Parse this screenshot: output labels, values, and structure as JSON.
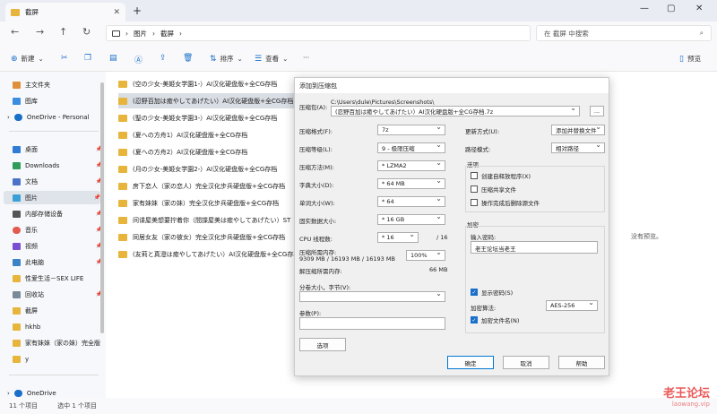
{
  "window": {
    "tab_title": "截屏",
    "tab_close": "✕",
    "new_tab": "+",
    "minimize": "—",
    "maximize": "▢",
    "close": "✕"
  },
  "address": {
    "crumb1": "图片",
    "crumb2": "截屏",
    "search_placeholder": "在 截屏 中搜索"
  },
  "toolbar": {
    "new_label": "新建",
    "sort_label": "排序",
    "view_label": "查看",
    "more_label": "···",
    "details_label": "预览"
  },
  "sidebar": {
    "items": [
      {
        "label": "主文件夹",
        "color": "#e0903a"
      },
      {
        "label": "图库",
        "color": "#3b8de0"
      },
      {
        "label": "OneDrive - Personal",
        "color": "#1a6fc9"
      },
      {
        "label": "桌面",
        "color": "#2f7bd6"
      },
      {
        "label": "Downloads",
        "color": "#2f9c5a"
      },
      {
        "label": "文档",
        "color": "#4b74c9"
      },
      {
        "label": "图片",
        "color": "#3ca0d8"
      },
      {
        "label": "内部存储设备",
        "color": "#555555"
      },
      {
        "label": "音乐",
        "color": "#e35a4f"
      },
      {
        "label": "视频",
        "color": "#7a4fd1"
      },
      {
        "label": "此电脑",
        "color": "#3c82c7"
      },
      {
        "label": "性爱生活－SEX LIFE",
        "color": "#e7b53c"
      },
      {
        "label": "回收站",
        "color": "#7a8a9a"
      },
      {
        "label": "截屏",
        "color": "#e7b53c"
      },
      {
        "label": "hkhb",
        "color": "#e7b53c"
      },
      {
        "label": "家有妹妹（家の妹）完全版",
        "color": "#e7b53c"
      },
      {
        "label": "y",
        "color": "#e7b53c"
      },
      {
        "label": "OneDrive",
        "color": "#1a6fc9"
      }
    ]
  },
  "files": [
    "(空の少女-美姫女学園1-）AI汉化硬盘版+全CG存档",
    "(忍野百加は癒やしてあげたい）AI汉化硬盘版+全CG存档",
    "(聖の少女-美姫女学園3-）AI汉化硬盘版+全CG存档",
    "(夏への方舟1）AI汉化硬盘版+全CG存档",
    "(夏への方舟2）AI汉化硬盘版+全CG存档",
    "(月の少女-美姫女学園2-）AI汉化硬盘版+全CG存档",
    "房下恋人（家の恋人）完全汉化步兵硬盘版+全CG存档",
    "家有妹妹（家の妹）完全汉化步兵硬盘版+全CG存档",
    "间谍屋美想要拧着你（間諜屋美は癒やしてあげたい）ST",
    "同居女友（家の彼女）完全汉化步兵硬盘版+全CG存档",
    "(友莉と真澄は癒やしてあげたい）AI汉化硬盘版+全CG存档"
  ],
  "preview_empty": "没有预览。",
  "status": {
    "count": "11 个项目",
    "selected": "选中 1 个项目"
  },
  "watermark": {
    "line1": "老王论坛",
    "line2": "laowang.vip"
  },
  "dialog": {
    "title": "添加到压缩包",
    "archive_label": "压缩包(A):",
    "archive_path": "C:\\Users\\dule\\Pictures\\Screenshots\\",
    "archive_name": "(忍野百加は癒やしてあげたい）AI汉化硬盘版+全CG存档.7z",
    "browse": "...",
    "format_label": "压缩格式(F):",
    "format_value": "7z",
    "level_label": "压缩等级(L):",
    "level_value": "9 - 极限压缩",
    "method_label": "压缩方法(M):",
    "method_value": "* LZMA2",
    "dict_label": "字典大小(D):",
    "dict_value": "* 64 MB",
    "word_label": "单词大小(W):",
    "word_value": "* 64",
    "solid_label": "固实数据大小:",
    "solid_value": "* 16 GB",
    "cpu_label": "CPU 线程数:",
    "cpu_value": "* 16",
    "cpu_total": "/ 16",
    "mem_label": "压缩所需内存:",
    "mem_value": "9309 MB / 16193 MB / 16193 MB",
    "mem_pct": "100%",
    "decomp_label": "解压缩所需内存:",
    "decomp_value": "66 MB",
    "split_label": "分卷大小，字节(V):",
    "params_label": "参数(P):",
    "options_button": "选项",
    "update_label": "更新方式(U):",
    "update_value": "添加并替换文件",
    "path_label": "路径模式:",
    "path_value": "相对路径",
    "options_group": "选项",
    "opt_sfx": "创建自释放程序(X)",
    "opt_shared": "压缩共享文件",
    "opt_delete": "操作完成后删除源文件",
    "encrypt_group": "加密",
    "password_label": "输入密码:",
    "password_value": "老王论坛当老王",
    "show_password": "显示密码(S)",
    "enc_method_label": "加密算法:",
    "enc_method_value": "AES-256",
    "encrypt_names": "加密文件名(N)",
    "ok": "确定",
    "cancel": "取消",
    "help": "帮助"
  }
}
